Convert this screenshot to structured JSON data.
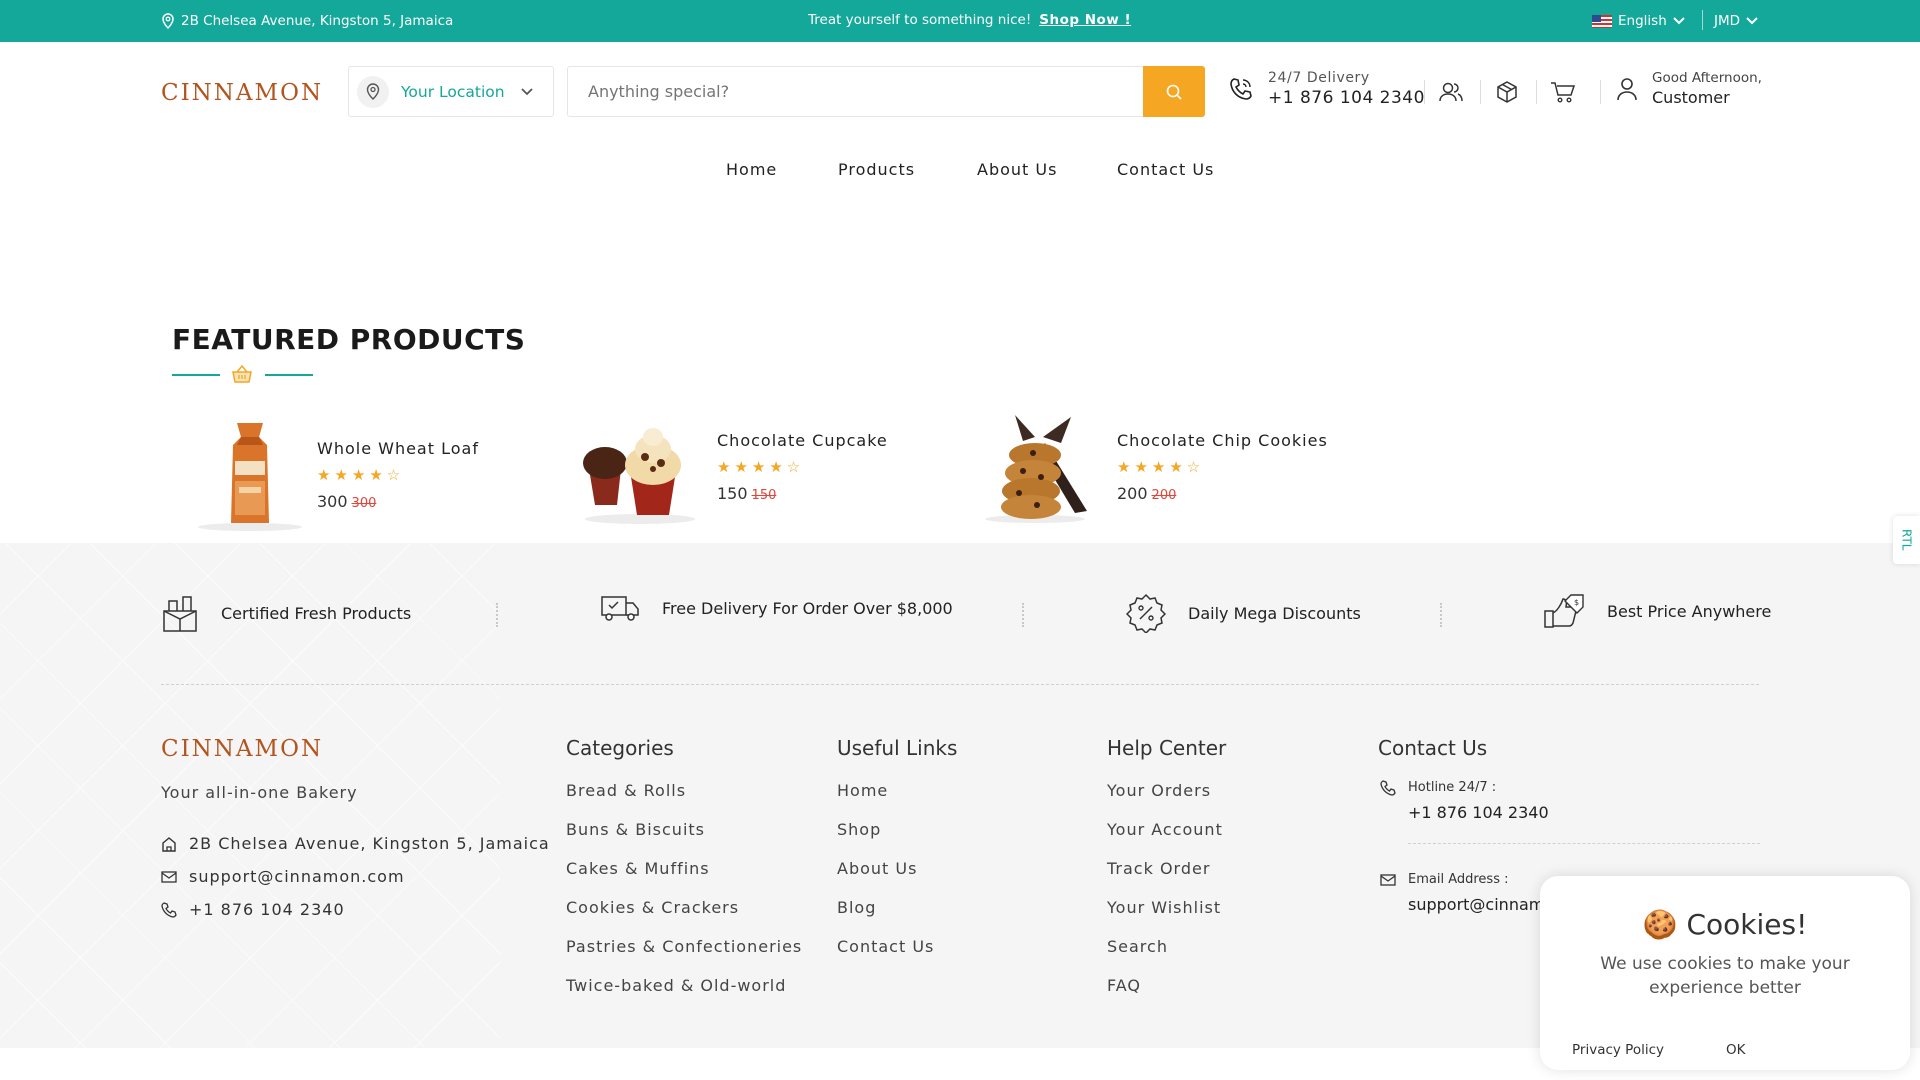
{
  "colors": {
    "brand_teal": "#13a89a",
    "accent_orange": "#f5a623",
    "logo_brown": "#b3541e",
    "old_price_red": "#e0453a"
  },
  "topbar": {
    "address": "2B Chelsea Avenue, Kingston 5, Jamaica",
    "promo_text": "Treat yourself to something nice!",
    "promo_link": "Shop Now !",
    "language": "English",
    "currency": "JMD"
  },
  "header": {
    "logo": "CINNAMON",
    "location_label": "Your Location",
    "search_placeholder": "Anything special?",
    "delivery_label": "24/7 Delivery",
    "delivery_phone": "+1 876 104 2340",
    "greeting": "Good Afternoon,",
    "user_name": "Customer",
    "icons": [
      "location-pin-icon",
      "search-icon",
      "phone-icon",
      "users-icon",
      "box-icon",
      "cart-icon",
      "user-icon"
    ]
  },
  "nav": {
    "items": [
      "Home",
      "Products",
      "About Us",
      "Contact Us"
    ]
  },
  "featured": {
    "title": "FEATURED PRODUCTS",
    "products": [
      {
        "name": "Whole Wheat Loaf",
        "rating": 4,
        "price": "300",
        "old_price": "300"
      },
      {
        "name": "Chocolate Cupcake",
        "rating": 4,
        "price": "150",
        "old_price": "150"
      },
      {
        "name": "Chocolate Chip Cookies",
        "rating": 4,
        "price": "200",
        "old_price": "200"
      }
    ]
  },
  "features": [
    {
      "label": "Certified Fresh Products",
      "icon": "basket-icon"
    },
    {
      "label": "Free Delivery For Order Over $8,000",
      "icon": "truck-icon"
    },
    {
      "label": "Daily Mega Discounts",
      "icon": "discount-icon"
    },
    {
      "label": "Best Price Anywhere",
      "icon": "price-tag-icon"
    }
  ],
  "footer": {
    "logo": "CINNAMON",
    "tagline": "Your all-in-one Bakery",
    "address": "2B Chelsea Avenue, Kingston 5, Jamaica",
    "email": "support@cinnamon.com",
    "phone": "+1 876 104 2340",
    "categories": {
      "title": "Categories",
      "links": [
        "Bread & Rolls",
        "Buns & Biscuits",
        "Cakes & Muffins",
        "Cookies & Crackers",
        "Pastries & Confectioneries",
        "Twice-baked & Old-world"
      ]
    },
    "useful_links": {
      "title": "Useful Links",
      "links": [
        "Home",
        "Shop",
        "About Us",
        "Blog",
        "Contact Us"
      ]
    },
    "help_center": {
      "title": "Help Center",
      "links": [
        "Your Orders",
        "Your Account",
        "Track Order",
        "Your Wishlist",
        "Search",
        "FAQ"
      ]
    },
    "contact": {
      "title": "Contact Us",
      "hotline_label": "Hotline 24/7 :",
      "hotline": "+1 876 104 2340",
      "email_label": "Email Address :",
      "email": "support@cinnamon.com"
    }
  },
  "rtl_label": "RTL",
  "cookie": {
    "title": "🍪 Cookies!",
    "message": "We use cookies to make your experience better",
    "policy": "Privacy Policy",
    "ok": "OK"
  }
}
